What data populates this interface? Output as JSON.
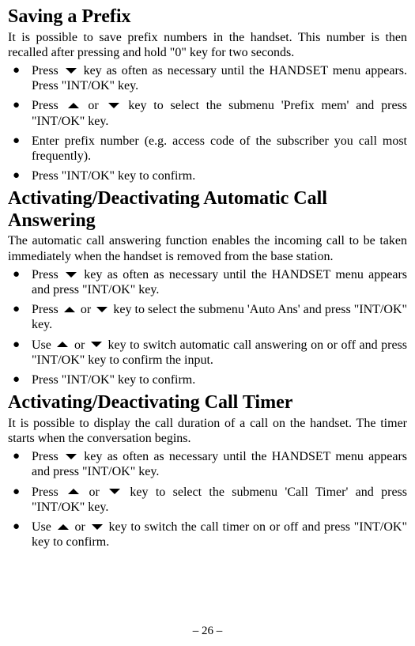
{
  "page_number": "– 26 –",
  "icons": {
    "up": "arrow-up",
    "down": "arrow-down"
  },
  "sections": [
    {
      "heading": "Saving a Prefix",
      "intro": "It is possible to save prefix numbers in the handset. This number is then recalled after pressing and hold \"0\" key for two seconds.",
      "steps": [
        {
          "parts": [
            {
              "t": "Press "
            },
            {
              "icon": "down"
            },
            {
              "t": " key as often as necessary until the HANDSET menu appears. Press \"INT/OK\" key."
            }
          ]
        },
        {
          "parts": [
            {
              "t": "Press "
            },
            {
              "icon": "up"
            },
            {
              "t": " or "
            },
            {
              "icon": "down"
            },
            {
              "t": " key to select the submenu 'Prefix mem' and press \"INT/OK\" key."
            }
          ]
        },
        {
          "parts": [
            {
              "t": "Enter prefix number (e.g. access code of the subscriber you call most frequently)."
            }
          ]
        },
        {
          "parts": [
            {
              "t": "Press \"INT/OK\" key to confirm."
            }
          ]
        }
      ]
    },
    {
      "heading": "Activating/Deactivating Automatic Call Answering",
      "intro": "The automatic call answering function enables the incoming call to be taken immediately when the handset is removed from the base station.",
      "steps": [
        {
          "parts": [
            {
              "t": "Press "
            },
            {
              "icon": "down"
            },
            {
              "t": " key as often as necessary until the HANDSET menu appears and press \"INT/OK\" key."
            }
          ]
        },
        {
          "parts": [
            {
              "t": "Press "
            },
            {
              "icon": "up"
            },
            {
              "t": " or "
            },
            {
              "icon": "down"
            },
            {
              "t": " key to select the submenu 'Auto Ans' and press \"INT/OK\" key."
            }
          ]
        },
        {
          "parts": [
            {
              "t": "Use "
            },
            {
              "icon": "up"
            },
            {
              "t": " or "
            },
            {
              "icon": "down"
            },
            {
              "t": " key to switch automatic call answering on or off and press \"INT/OK\" key to confirm the input."
            }
          ]
        },
        {
          "parts": [
            {
              "t": "Press \"INT/OK\" key to confirm."
            }
          ]
        }
      ]
    },
    {
      "heading": "Activating/Deactivating Call Timer",
      "intro": "It is possible to display the call duration of a call on the handset. The timer starts when the conversation begins.",
      "steps": [
        {
          "parts": [
            {
              "t": "Press "
            },
            {
              "icon": "down"
            },
            {
              "t": " key as often as necessary until the HANDSET menu appears and press \"INT/OK\" key."
            }
          ]
        },
        {
          "parts": [
            {
              "t": "Press "
            },
            {
              "icon": "up"
            },
            {
              "t": " or "
            },
            {
              "icon": "down"
            },
            {
              "t": " key to select the submenu 'Call Timer' and press \"INT/OK\" key."
            }
          ]
        },
        {
          "parts": [
            {
              "t": "Use "
            },
            {
              "icon": "up"
            },
            {
              "t": " or "
            },
            {
              "icon": "down"
            },
            {
              "t": " key to switch the call timer on or off and press \"INT/OK\" key to confirm."
            }
          ]
        }
      ]
    }
  ]
}
